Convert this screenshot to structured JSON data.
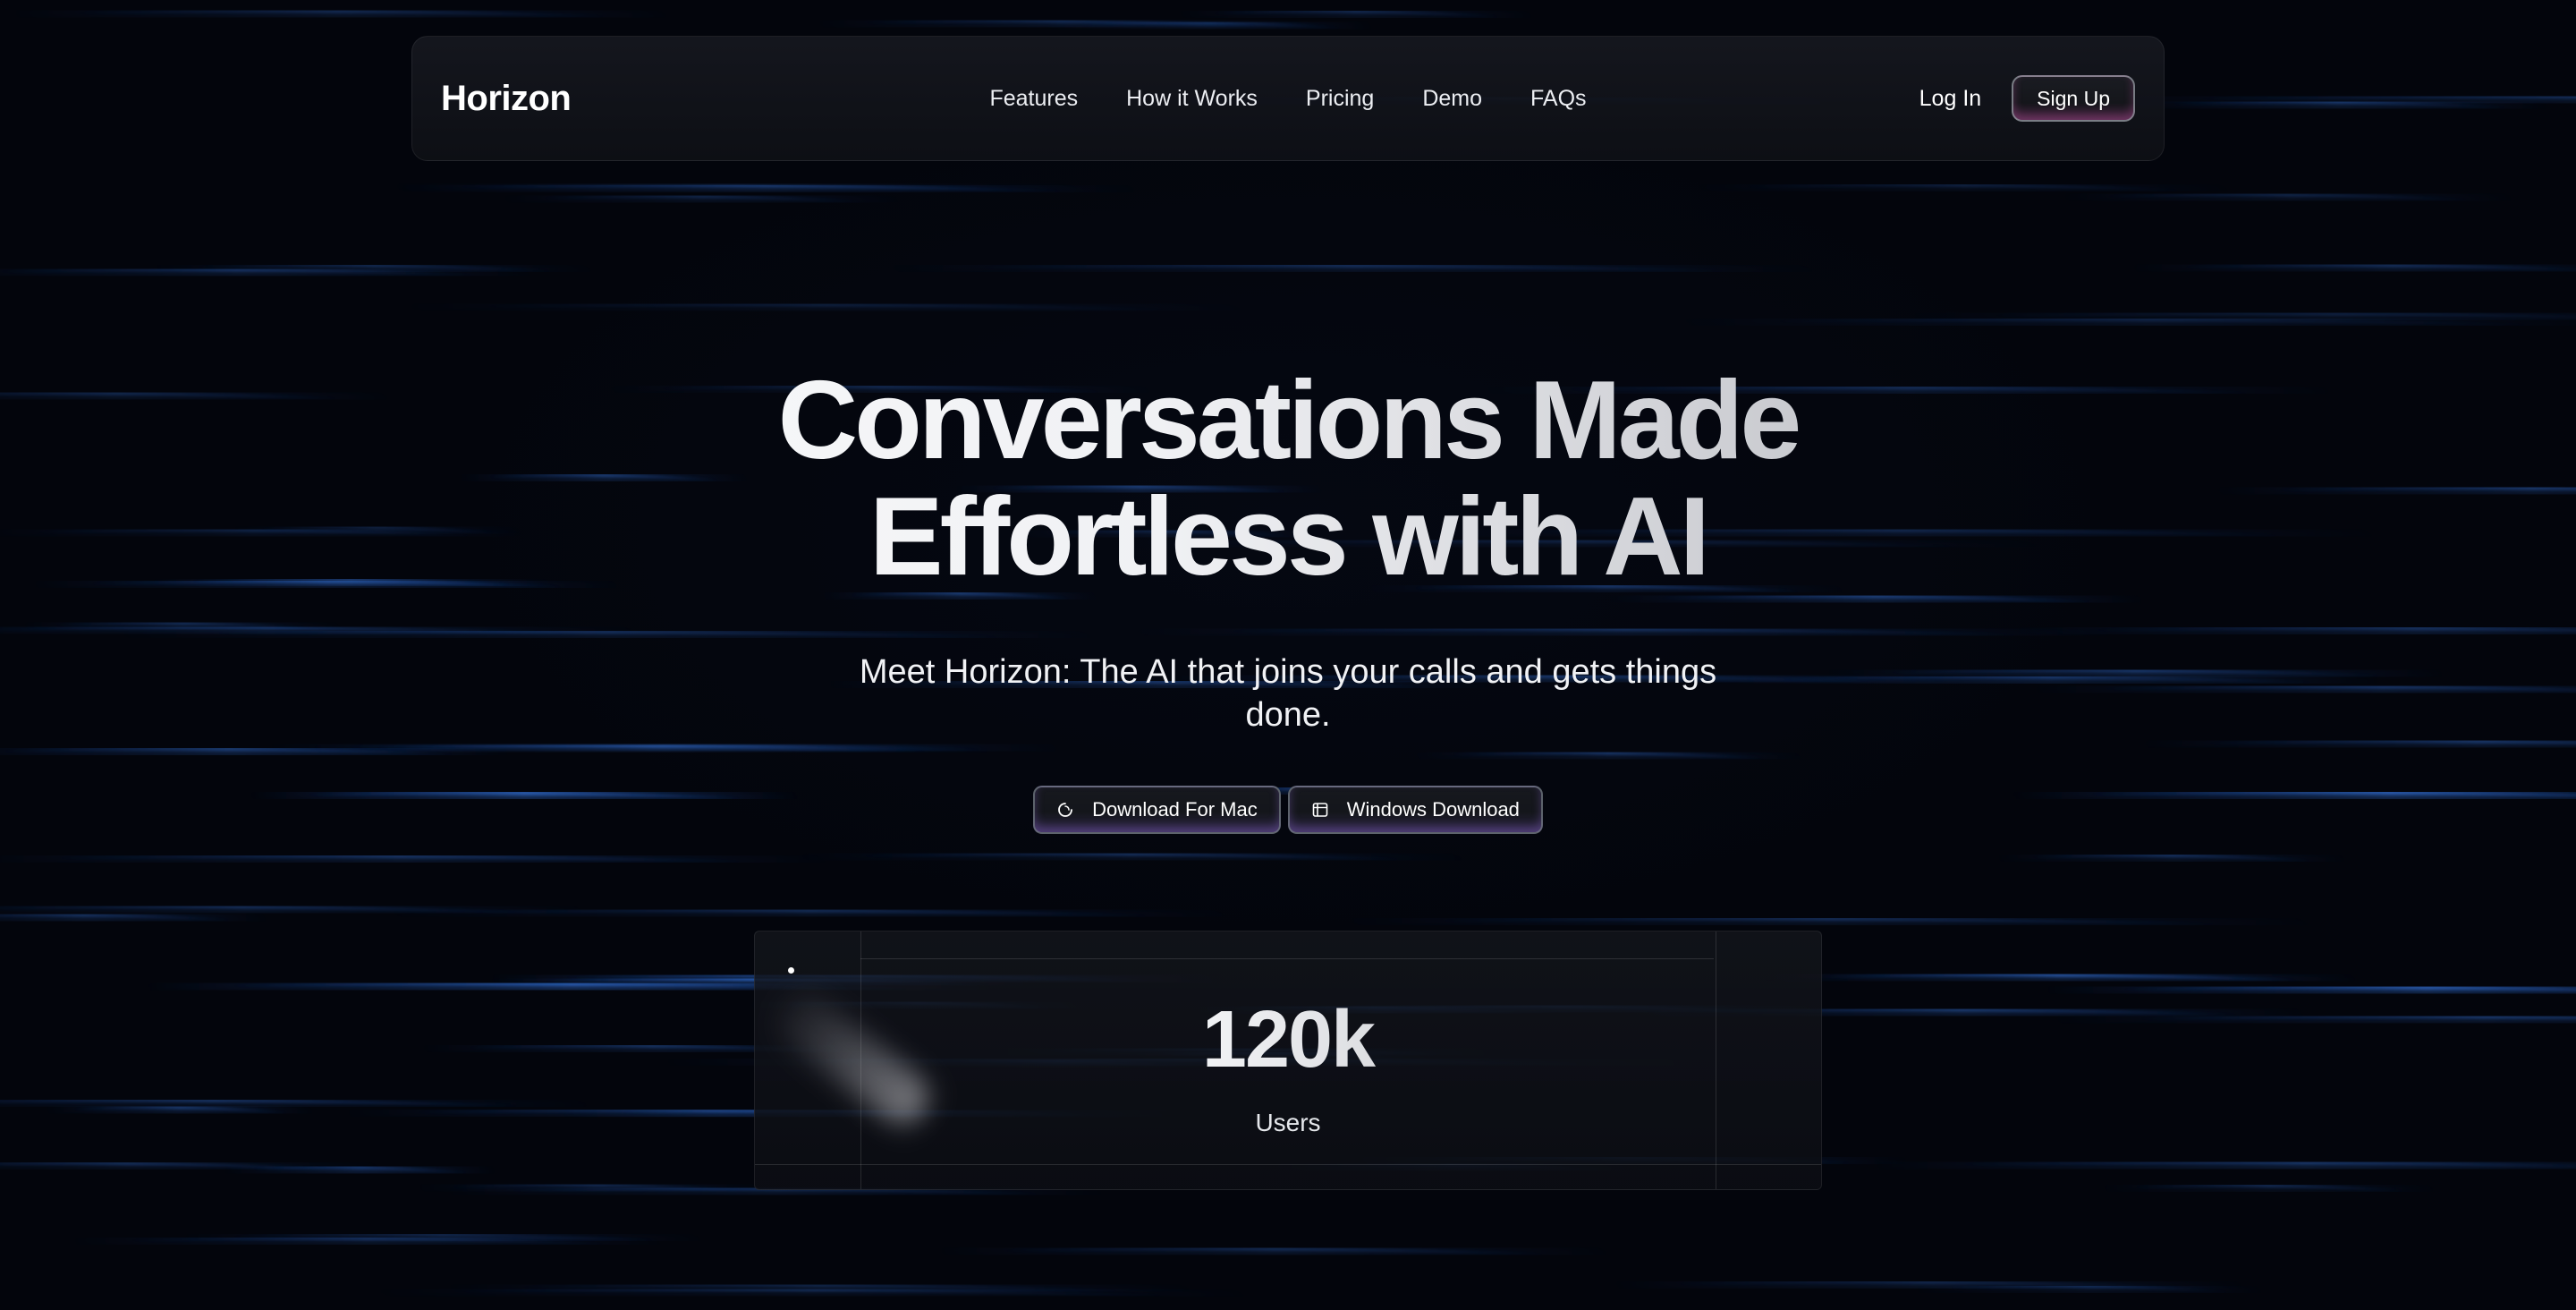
{
  "brand": {
    "name": "Horizon"
  },
  "nav": {
    "links": [
      {
        "label": "Features"
      },
      {
        "label": "How it Works"
      },
      {
        "label": "Pricing"
      },
      {
        "label": "Demo"
      },
      {
        "label": "FAQs"
      }
    ],
    "login_label": "Log In",
    "signup_label": "Sign Up"
  },
  "hero": {
    "title_line1": "Conversations Made",
    "title_line2": "Effortless with AI",
    "subtitle": "Meet Horizon: The AI that joins your calls and gets things done."
  },
  "cta": {
    "mac_label": "Download For Mac",
    "mac_icon": "apple-logo-icon",
    "windows_label": "Windows Download",
    "windows_icon": "windows-logo-icon"
  },
  "stats": {
    "value": "120k",
    "label": "Users"
  },
  "colors": {
    "background": "#03050c",
    "streak_blue": "#2d6fe0",
    "text": "#f4f5f7"
  }
}
